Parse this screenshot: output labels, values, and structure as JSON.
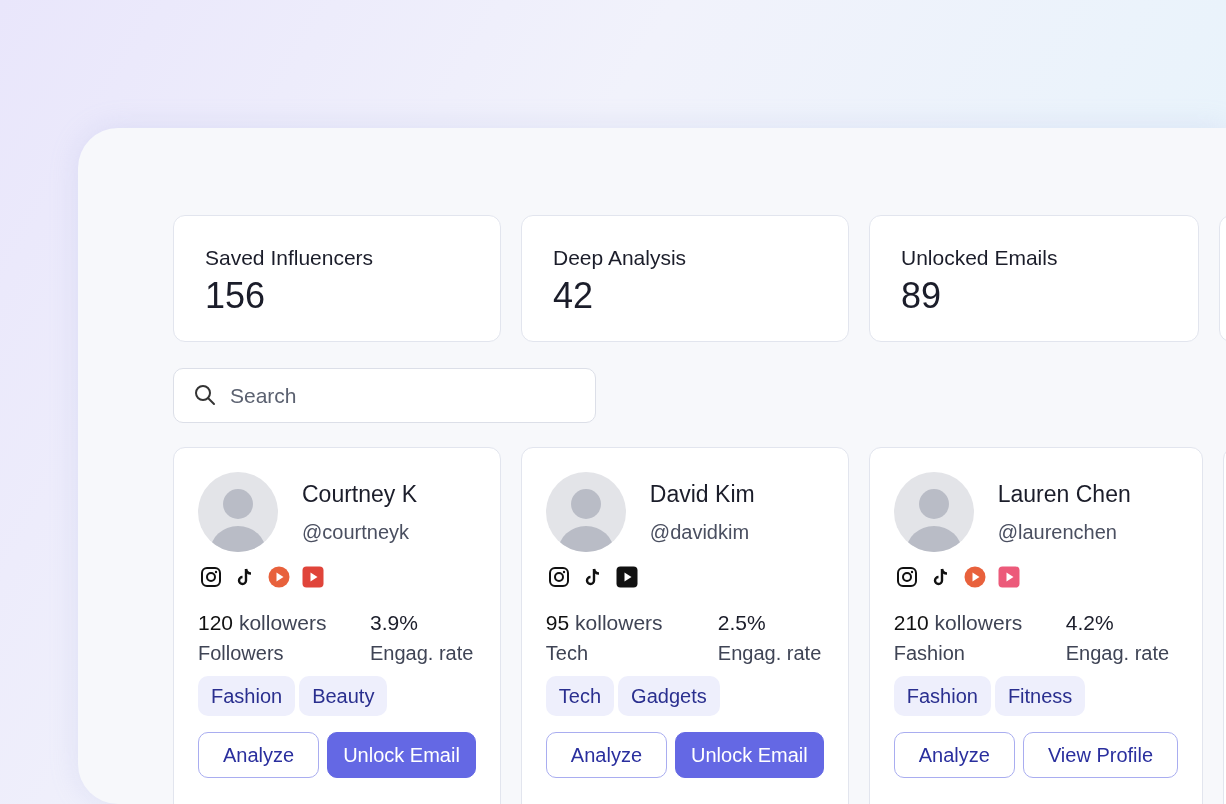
{
  "stats": [
    {
      "label": "Saved Influencers",
      "value": "156"
    },
    {
      "label": "Deep Analysis",
      "value": "42"
    },
    {
      "label": "Unlocked Emails",
      "value": "89"
    }
  ],
  "search": {
    "placeholder": "Search"
  },
  "influencers": [
    {
      "name": "Courtney K",
      "handle": "@courtneyk",
      "socials": [
        {
          "kind": "instagram"
        },
        {
          "kind": "tiktok"
        },
        {
          "kind": "play-circle",
          "color": "#e8613c"
        },
        {
          "kind": "play-square",
          "color": "#e0443a"
        }
      ],
      "followers": "120",
      "followers_unit": "kollowers",
      "followers_label": "Followers",
      "engagement": "3.9%",
      "engagement_label": "Engag. rate",
      "tags": [
        "Fashion",
        "Beauty"
      ],
      "buttons": [
        {
          "label": "Analyze",
          "kind": "outline"
        },
        {
          "label": "Unlock Email",
          "kind": "filled"
        }
      ]
    },
    {
      "name": "David Kim",
      "handle": "@davidkim",
      "socials": [
        {
          "kind": "instagram"
        },
        {
          "kind": "tiktok"
        },
        {
          "kind": "play-square",
          "color": "#111111"
        }
      ],
      "followers": "95",
      "followers_unit": "kollowers",
      "followers_label": "Tech",
      "engagement": "2.5%",
      "engagement_label": "Engag. rate",
      "tags": [
        "Tech",
        "Gadgets"
      ],
      "buttons": [
        {
          "label": "Analyze",
          "kind": "outline"
        },
        {
          "label": "Unlock Email",
          "kind": "filled"
        }
      ]
    },
    {
      "name": "Lauren Chen",
      "handle": "@laurenchen",
      "socials": [
        {
          "kind": "instagram"
        },
        {
          "kind": "tiktok"
        },
        {
          "kind": "play-circle",
          "color": "#e8613c"
        },
        {
          "kind": "play-square",
          "color": "#ec5a7a"
        }
      ],
      "followers": "210",
      "followers_unit": "kollowers",
      "followers_label": "Fashion",
      "engagement": "4.2%",
      "engagement_label": "Engag. rate",
      "tags": [
        "Fashion",
        "Fitness"
      ],
      "buttons": [
        {
          "label": "Analyze",
          "kind": "outline"
        },
        {
          "label": "View Profile",
          "kind": "outline"
        }
      ]
    }
  ]
}
